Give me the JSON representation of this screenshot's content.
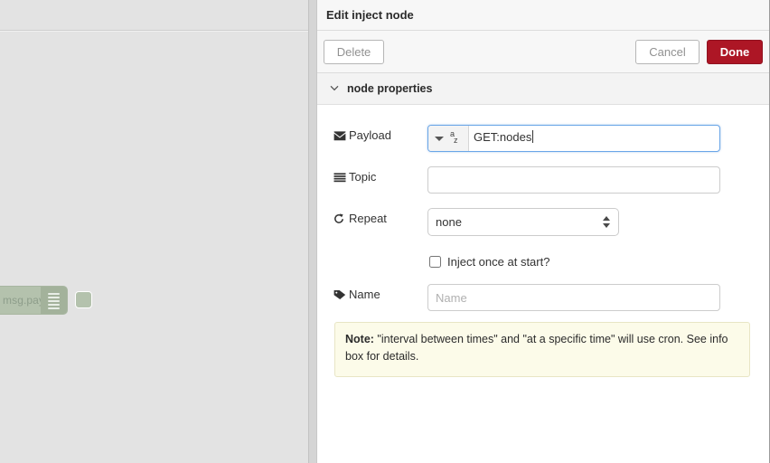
{
  "canvas": {
    "node": {
      "label": "msg.payload",
      "icon": "inject-lines-icon",
      "port": "output-port",
      "color": "#b4c2ad"
    }
  },
  "dialog": {
    "title": "Edit inject node",
    "toolbar": {
      "delete_label": "Delete",
      "cancel_label": "Cancel",
      "done_label": "Done",
      "done_color": "#ad1625"
    },
    "section": {
      "label": "node properties",
      "chevron": "chevron-down-icon",
      "expanded": true
    },
    "fields": {
      "payload": {
        "label": "Payload",
        "icon": "envelope-icon",
        "type_selector": {
          "caret": "caret-down-icon",
          "type_glyph_top": "a",
          "type_glyph_bottom": "z",
          "selected_type": "string"
        },
        "value": "GET:nodes"
      },
      "topic": {
        "label": "Topic",
        "icon": "list-bars-icon",
        "value": "",
        "placeholder": ""
      },
      "repeat": {
        "label": "Repeat",
        "icon": "refresh-icon",
        "selected": "none",
        "options": [
          "none"
        ]
      },
      "inject_once": {
        "label": "Inject once at start?",
        "checked": false
      },
      "name": {
        "label": "Name",
        "icon": "tag-icon",
        "value": "",
        "placeholder": "Name"
      }
    },
    "note": {
      "prefix": "Note:",
      "line1": " \"interval between times\" and \"at a specific time\" will use cron.",
      "line2": "See info box for details."
    }
  }
}
